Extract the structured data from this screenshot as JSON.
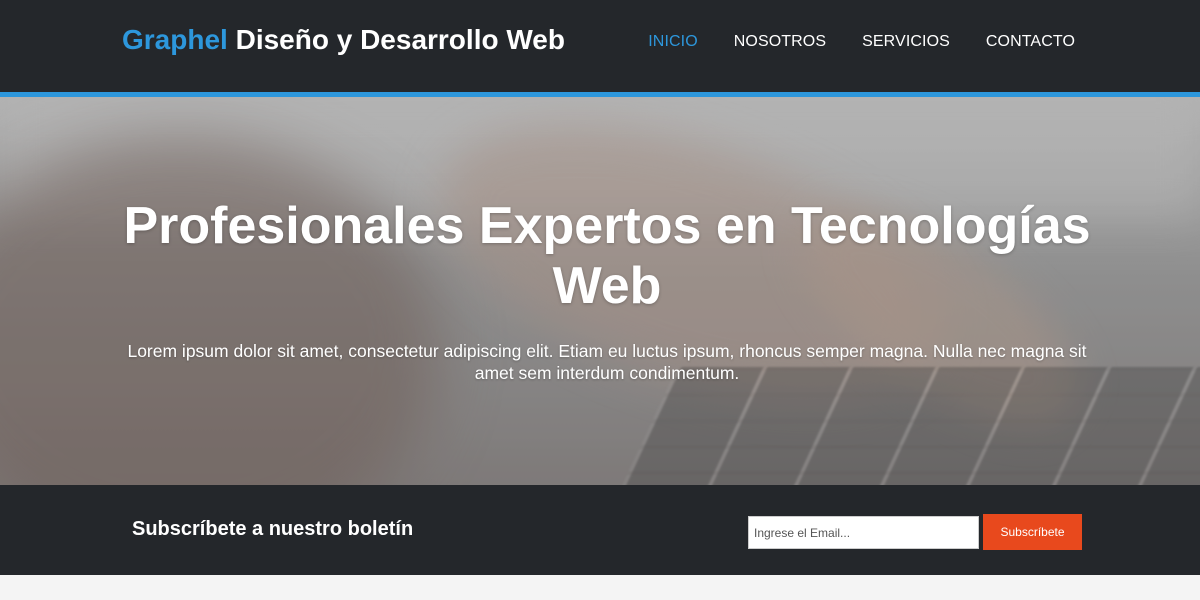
{
  "header": {
    "brand_accent": "Graphel",
    "brand_rest": " Diseño y Desarrollo Web",
    "nav": [
      {
        "label": "INICIO",
        "active": true
      },
      {
        "label": "NOSOTROS",
        "active": false
      },
      {
        "label": "SERVICIOS",
        "active": false
      },
      {
        "label": "CONTACTO",
        "active": false
      }
    ]
  },
  "hero": {
    "title": "Profesionales Expertos en Tecnologías Web",
    "text": "Lorem ipsum dolor sit amet, consectetur adipiscing elit. Etiam eu luctus ipsum, rhoncus semper magna. Nulla nec magna sit amet sem interdum condimentum."
  },
  "newsletter": {
    "title": "Subscríbete a nuestro boletín",
    "email_placeholder": "Ingrese el Email...",
    "email_value": "",
    "button_label": "Subscríbete"
  },
  "colors": {
    "accent": "#2d97dc",
    "dark": "#24272b",
    "button": "#e8491d"
  }
}
